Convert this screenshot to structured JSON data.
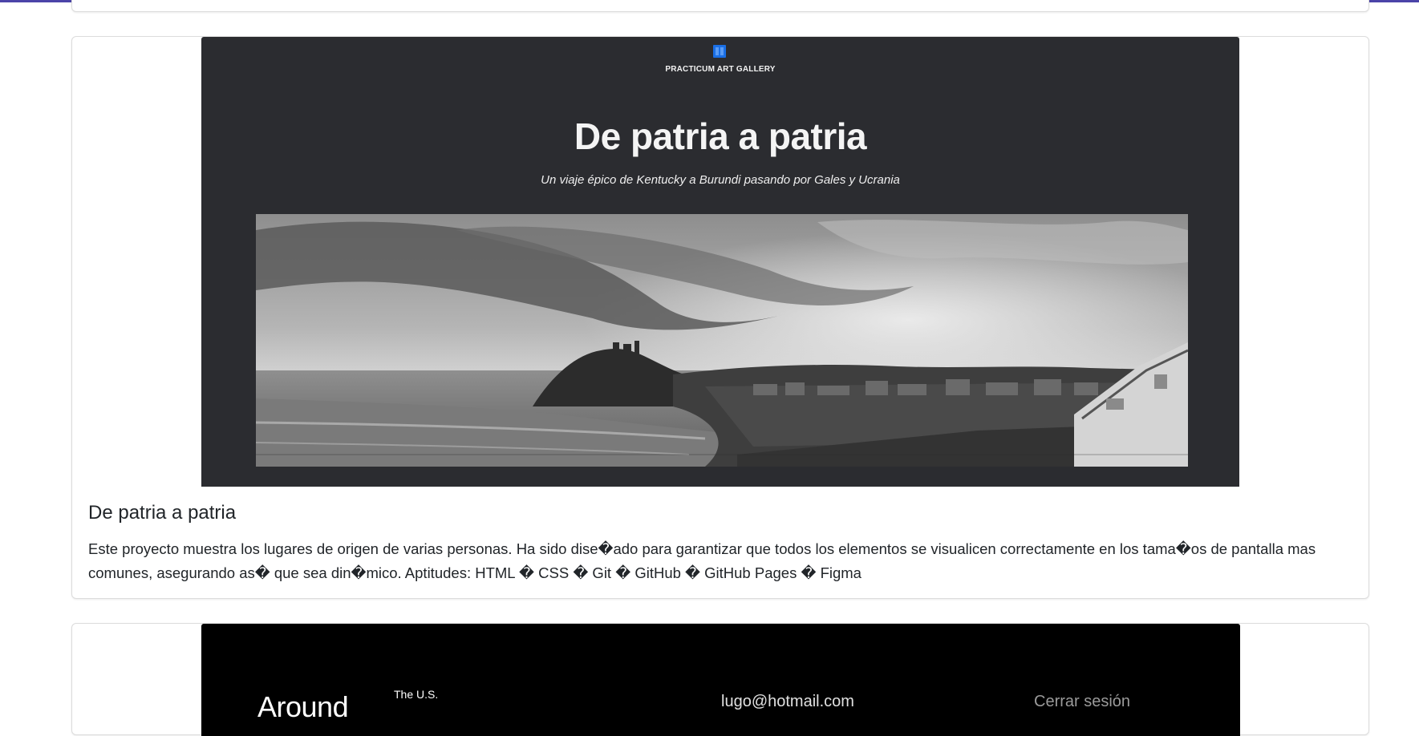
{
  "colors": {
    "top_accent": "#4b44a8",
    "screenshot_bg": "#2b2c30",
    "logo_blue": "#1a6fe6"
  },
  "project": {
    "preview": {
      "logo_icon": "gallery-logo-icon",
      "gallery_name": "PRACTICUM ART GALLERY",
      "hero_title": "De patria a patria",
      "hero_subtitle": "Un viaje épico de Kentucky a Burundi pasando por Gales y Ucrania"
    },
    "title": "De patria a patria",
    "description": "Este proyecto muestra los lugares de origen de varias personas. Ha sido dise�ado para garantizar que todos los elementos se visualicen correctamente en los tama�os de pantalla mas comunes, asegurando as� que sea din�mico. Aptitudes: HTML � CSS � Git � GitHub � GitHub Pages � Figma"
  },
  "next_project": {
    "preview": {
      "logo": "Around",
      "logo_sup": "The U.S.",
      "email": "lugo@hotmail.com",
      "logout": "Cerrar sesión"
    }
  }
}
